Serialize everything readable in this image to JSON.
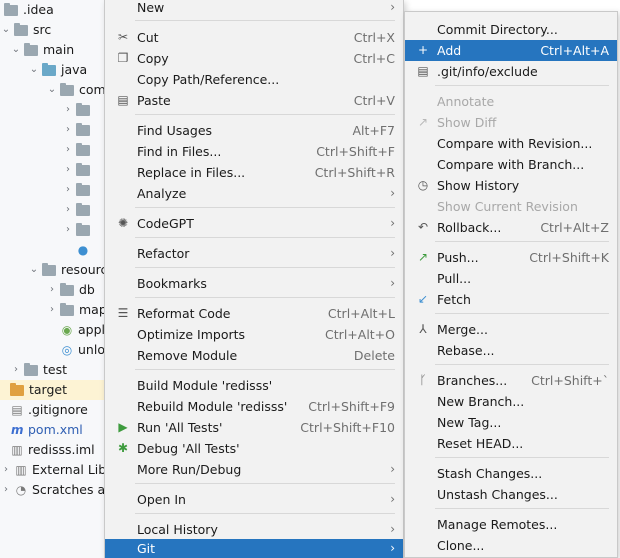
{
  "tree": {
    "rows": [
      {
        "label": ".idea",
        "indent": 0
      },
      {
        "label": "src",
        "indent": 0
      },
      {
        "label": "main",
        "indent": 1
      },
      {
        "label": "java",
        "indent": 2
      },
      {
        "label": "com",
        "indent": 3
      },
      {
        "label": "resources",
        "indent": 2
      },
      {
        "label": "db",
        "indent": 3
      },
      {
        "label": "mapper",
        "indent": 3
      },
      {
        "label": "application",
        "indent": 3
      },
      {
        "label": "unlo",
        "indent": 3
      },
      {
        "label": "test",
        "indent": 1
      },
      {
        "label": "target",
        "indent": 0
      },
      {
        "label": ".gitignore",
        "indent": 0
      },
      {
        "label": "pom.xml",
        "indent": 0
      },
      {
        "label": "redisss.iml",
        "indent": 0
      },
      {
        "label": "External Libraries",
        "indent": 0
      },
      {
        "label": "Scratches and Consoles",
        "indent": 0
      }
    ]
  },
  "context_menu": {
    "items": [
      {
        "label": "New",
        "shortcut": ""
      },
      {
        "label": "Cut",
        "shortcut": "Ctrl+X"
      },
      {
        "label": "Copy",
        "shortcut": "Ctrl+C"
      },
      {
        "label": "Copy Path/Reference...",
        "shortcut": ""
      },
      {
        "label": "Paste",
        "shortcut": "Ctrl+V"
      },
      {
        "label": "Find Usages",
        "shortcut": "Alt+F7"
      },
      {
        "label": "Find in Files...",
        "shortcut": "Ctrl+Shift+F"
      },
      {
        "label": "Replace in Files...",
        "shortcut": "Ctrl+Shift+R"
      },
      {
        "label": "Analyze",
        "shortcut": ""
      },
      {
        "label": "CodeGPT",
        "shortcut": ""
      },
      {
        "label": "Refactor",
        "shortcut": ""
      },
      {
        "label": "Bookmarks",
        "shortcut": ""
      },
      {
        "label": "Reformat Code",
        "shortcut": "Ctrl+Alt+L"
      },
      {
        "label": "Optimize Imports",
        "shortcut": "Ctrl+Alt+O"
      },
      {
        "label": "Remove Module",
        "shortcut": "Delete"
      },
      {
        "label": "Build Module 'redisss'",
        "shortcut": ""
      },
      {
        "label": "Rebuild Module 'redisss'",
        "shortcut": "Ctrl+Shift+F9"
      },
      {
        "label": "Run 'All Tests'",
        "shortcut": "Ctrl+Shift+F10"
      },
      {
        "label": "Debug 'All Tests'",
        "shortcut": ""
      },
      {
        "label": "More Run/Debug",
        "shortcut": ""
      },
      {
        "label": "Open In",
        "shortcut": ""
      },
      {
        "label": "Local History",
        "shortcut": ""
      },
      {
        "label": "Git",
        "shortcut": ""
      }
    ]
  },
  "git_menu": {
    "items": [
      {
        "label": "Commit Directory...",
        "shortcut": ""
      },
      {
        "label": "Add",
        "shortcut": "Ctrl+Alt+A"
      },
      {
        "label": ".git/info/exclude",
        "shortcut": ""
      },
      {
        "label": "Annotate",
        "shortcut": ""
      },
      {
        "label": "Show Diff",
        "shortcut": ""
      },
      {
        "label": "Compare with Revision...",
        "shortcut": ""
      },
      {
        "label": "Compare with Branch...",
        "shortcut": ""
      },
      {
        "label": "Show History",
        "shortcut": ""
      },
      {
        "label": "Show Current Revision",
        "shortcut": ""
      },
      {
        "label": "Rollback...",
        "shortcut": "Ctrl+Alt+Z"
      },
      {
        "label": "Push...",
        "shortcut": "Ctrl+Shift+K"
      },
      {
        "label": "Pull...",
        "shortcut": ""
      },
      {
        "label": "Fetch",
        "shortcut": ""
      },
      {
        "label": "Merge...",
        "shortcut": ""
      },
      {
        "label": "Rebase...",
        "shortcut": ""
      },
      {
        "label": "Branches...",
        "shortcut": "Ctrl+Shift+`"
      },
      {
        "label": "New Branch...",
        "shortcut": ""
      },
      {
        "label": "New Tag...",
        "shortcut": ""
      },
      {
        "label": "Reset HEAD...",
        "shortcut": ""
      },
      {
        "label": "Stash Changes...",
        "shortcut": ""
      },
      {
        "label": "Unstash Changes...",
        "shortcut": ""
      },
      {
        "label": "Manage Remotes...",
        "shortcut": ""
      },
      {
        "label": "Clone...",
        "shortcut": ""
      }
    ]
  },
  "colors": {
    "highlight": "#2675bf",
    "disabled": "#a8a8a8",
    "selected_row": "#fdf3d4"
  }
}
